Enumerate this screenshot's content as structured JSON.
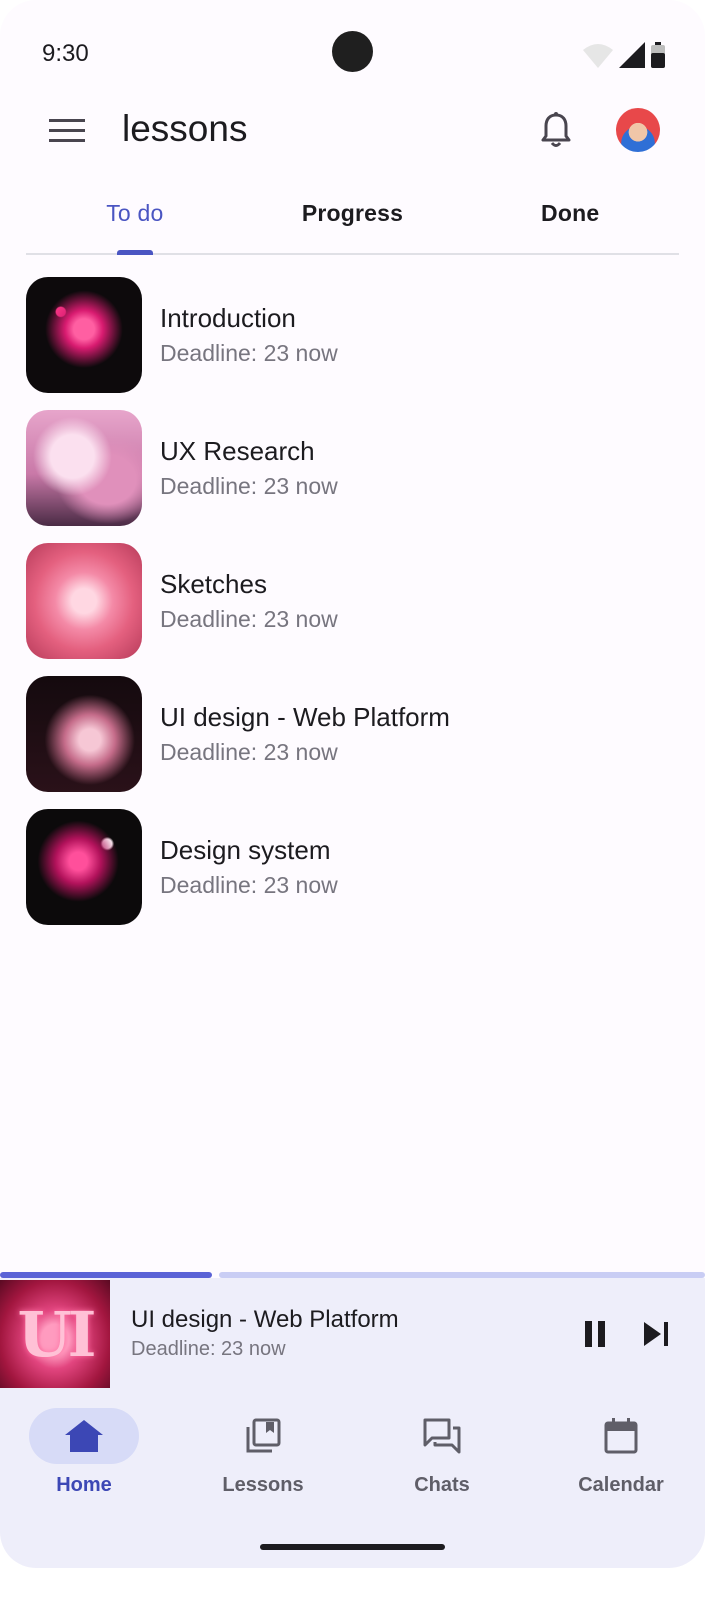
{
  "status_bar": {
    "time": "9:30"
  },
  "app_bar": {
    "title": "lessons"
  },
  "tabs": [
    {
      "label": "To do",
      "active": true
    },
    {
      "label": "Progress",
      "active": false
    },
    {
      "label": "Done",
      "active": false
    }
  ],
  "lessons": [
    {
      "title": "Introduction",
      "subtitle": "Deadline: 23 now"
    },
    {
      "title": "UX Research",
      "subtitle": "Deadline: 23 now"
    },
    {
      "title": "Sketches",
      "subtitle": "Deadline: 23 now"
    },
    {
      "title": "UI design - Web Platform",
      "subtitle": "Deadline: 23 now"
    },
    {
      "title": "Design system",
      "subtitle": "Deadline: 23 now"
    }
  ],
  "mini_player": {
    "art_text": "UI",
    "title": "UI design - Web Platform",
    "subtitle": "Deadline: 23 now",
    "progress": 0.3
  },
  "nav": [
    {
      "label": "Home",
      "icon": "home-icon",
      "active": true
    },
    {
      "label": "Lessons",
      "icon": "library-icon",
      "active": false
    },
    {
      "label": "Chats",
      "icon": "chat-icon",
      "active": false
    },
    {
      "label": "Calendar",
      "icon": "calendar-icon",
      "active": false
    }
  ],
  "colors": {
    "accent": "#4a55c2",
    "surface": "#eeeefa",
    "progress": "#5a62d6"
  }
}
